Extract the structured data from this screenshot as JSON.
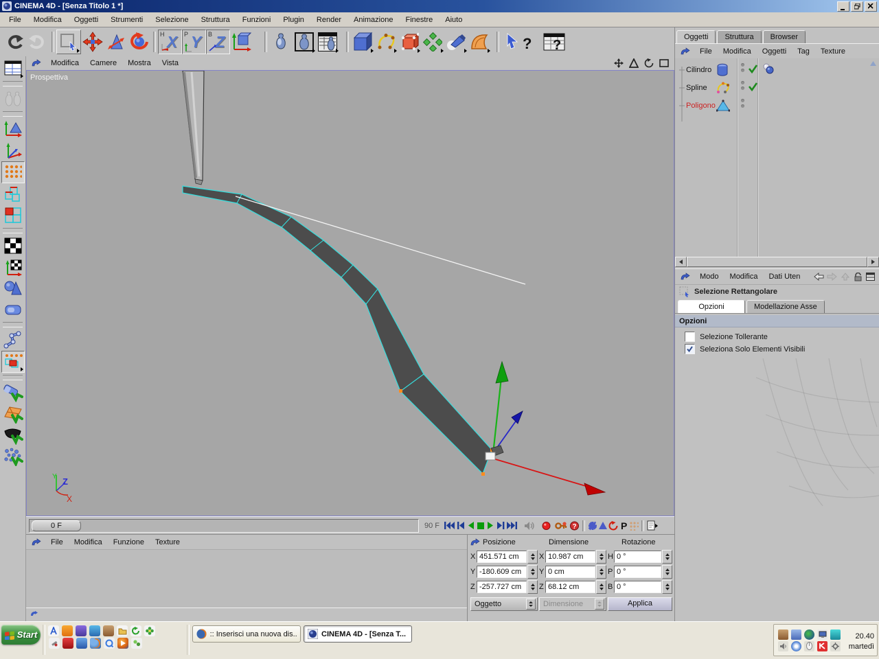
{
  "window": {
    "title": "CINEMA 4D - [Senza Titolo 1 *]"
  },
  "menubar": {
    "items": [
      "File",
      "Modifica",
      "Oggetti",
      "Strumenti",
      "Selezione",
      "Struttura",
      "Funzioni",
      "Plugin",
      "Render",
      "Animazione",
      "Finestre",
      "Aiuto"
    ]
  },
  "toolbar": {
    "axis_buttons": [
      {
        "small": "H",
        "big": "X"
      },
      {
        "small": "P",
        "big": "Y"
      },
      {
        "small": "B",
        "big": "Z"
      }
    ],
    "help_glyph": "?"
  },
  "viewport": {
    "menu": [
      "Modifica",
      "Camere",
      "Mostra",
      "Vista"
    ],
    "camera_label": "Prospettiva",
    "axis_labels": {
      "x": "X",
      "y": "Y",
      "z": "Z"
    }
  },
  "timeline": {
    "current_frame": "0 F",
    "end_frame": "90 F"
  },
  "transport": {
    "p_label": "P"
  },
  "materials_panel": {
    "menu": [
      "File",
      "Modifica",
      "Funzione",
      "Texture"
    ]
  },
  "coordinates": {
    "columns": [
      {
        "title": "Posizione",
        "rows": [
          {
            "axis": "X",
            "value": "451.571 cm"
          },
          {
            "axis": "Y",
            "value": "-180.609 cm"
          },
          {
            "axis": "Z",
            "value": "-257.727 cm"
          }
        ],
        "footer": "Oggetto"
      },
      {
        "title": "Dimensione",
        "rows": [
          {
            "axis": "X",
            "value": "10.987 cm"
          },
          {
            "axis": "Y",
            "value": "0 cm"
          },
          {
            "axis": "Z",
            "value": "68.12 cm"
          }
        ],
        "footer": "Dimensione"
      },
      {
        "title": "Rotazione",
        "rows": [
          {
            "axis": "H",
            "value": "0 °"
          },
          {
            "axis": "P",
            "value": "0 °"
          },
          {
            "axis": "B",
            "value": "0 °"
          }
        ],
        "footer": "Applica"
      }
    ]
  },
  "object_manager": {
    "tabs": [
      "Oggetti",
      "Struttura",
      "Browser"
    ],
    "menu": [
      "File",
      "Modifica",
      "Oggetti",
      "Tag",
      "Texture"
    ],
    "objects": [
      {
        "name": "Cilindro",
        "enabled": true,
        "selected": false
      },
      {
        "name": "Spline",
        "enabled": true,
        "selected": false
      },
      {
        "name": "Poligono",
        "enabled": false,
        "selected": true
      }
    ]
  },
  "attribute_manager": {
    "menu": [
      "Modo",
      "Modifica",
      "Dati Uten"
    ],
    "tool_title": "Selezione Rettangolare",
    "tabs": [
      "Opzioni",
      "Modellazione Asse"
    ],
    "section_title": "Opzioni",
    "options": [
      {
        "label": "Selezione Tollerante",
        "checked": false
      },
      {
        "label": "Seleziona Solo Elementi Visibili",
        "checked": true
      }
    ]
  },
  "taskbar": {
    "start_label": "Start",
    "tasks": [
      ":: Inserisci una nuova dis...",
      "CINEMA 4D - [Senza T..."
    ],
    "clock": "20.40",
    "day": "martedì"
  },
  "colors": {
    "selection_cyan": "#35dede",
    "selected_object_red": "#cc2222",
    "check_green": "#1e8a1e",
    "axis_x_red": "#d81414",
    "axis_y_green": "#18b418",
    "axis_z_blue": "#2828c8",
    "viewport_bg": "#a6a6a6",
    "titlebar_blue": "#0a246a"
  }
}
